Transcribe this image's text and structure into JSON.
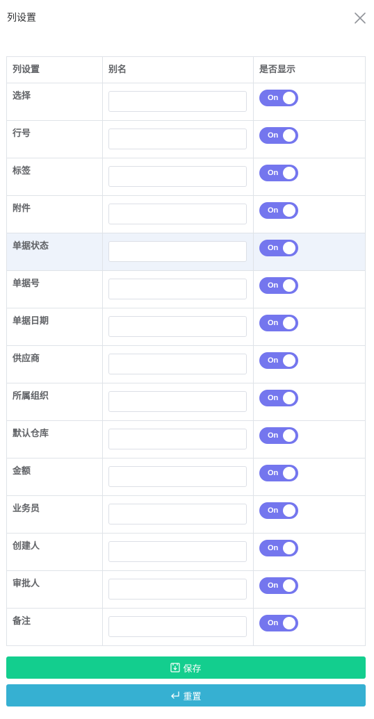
{
  "dialog": {
    "title": "列设置"
  },
  "grid": {
    "headers": [
      "列设置",
      "别名",
      "是否显示"
    ],
    "rows": [
      {
        "label": "选择",
        "alias": "",
        "visible": "On"
      },
      {
        "label": "行号",
        "alias": "",
        "visible": "On"
      },
      {
        "label": "标签",
        "alias": "",
        "visible": "On"
      },
      {
        "label": "附件",
        "alias": "",
        "visible": "On"
      },
      {
        "label": "单据状态",
        "alias": "",
        "visible": "On"
      },
      {
        "label": "单据号",
        "alias": "",
        "visible": "On"
      },
      {
        "label": "单据日期",
        "alias": "",
        "visible": "On"
      },
      {
        "label": "供应商",
        "alias": "",
        "visible": "On"
      },
      {
        "label": "所属组织",
        "alias": "",
        "visible": "On"
      },
      {
        "label": "默认仓库",
        "alias": "",
        "visible": "On"
      },
      {
        "label": "金额",
        "alias": "",
        "visible": "On"
      },
      {
        "label": "业务员",
        "alias": "",
        "visible": "On"
      },
      {
        "label": "创建人",
        "alias": "",
        "visible": "On"
      },
      {
        "label": "审批人",
        "alias": "",
        "visible": "On"
      },
      {
        "label": "备注",
        "alias": "",
        "visible": "On"
      }
    ]
  },
  "actions": {
    "save_label": "保存",
    "reset_label": "重置"
  },
  "icons": {
    "close": "close-icon",
    "save": "save-icon",
    "reset": "enter-return-icon"
  },
  "colors": {
    "switch_on": "#7476ee",
    "save_button": "#13ce8e",
    "reset_button": "#36b0d2",
    "highlight_row": "#eef3fb"
  }
}
